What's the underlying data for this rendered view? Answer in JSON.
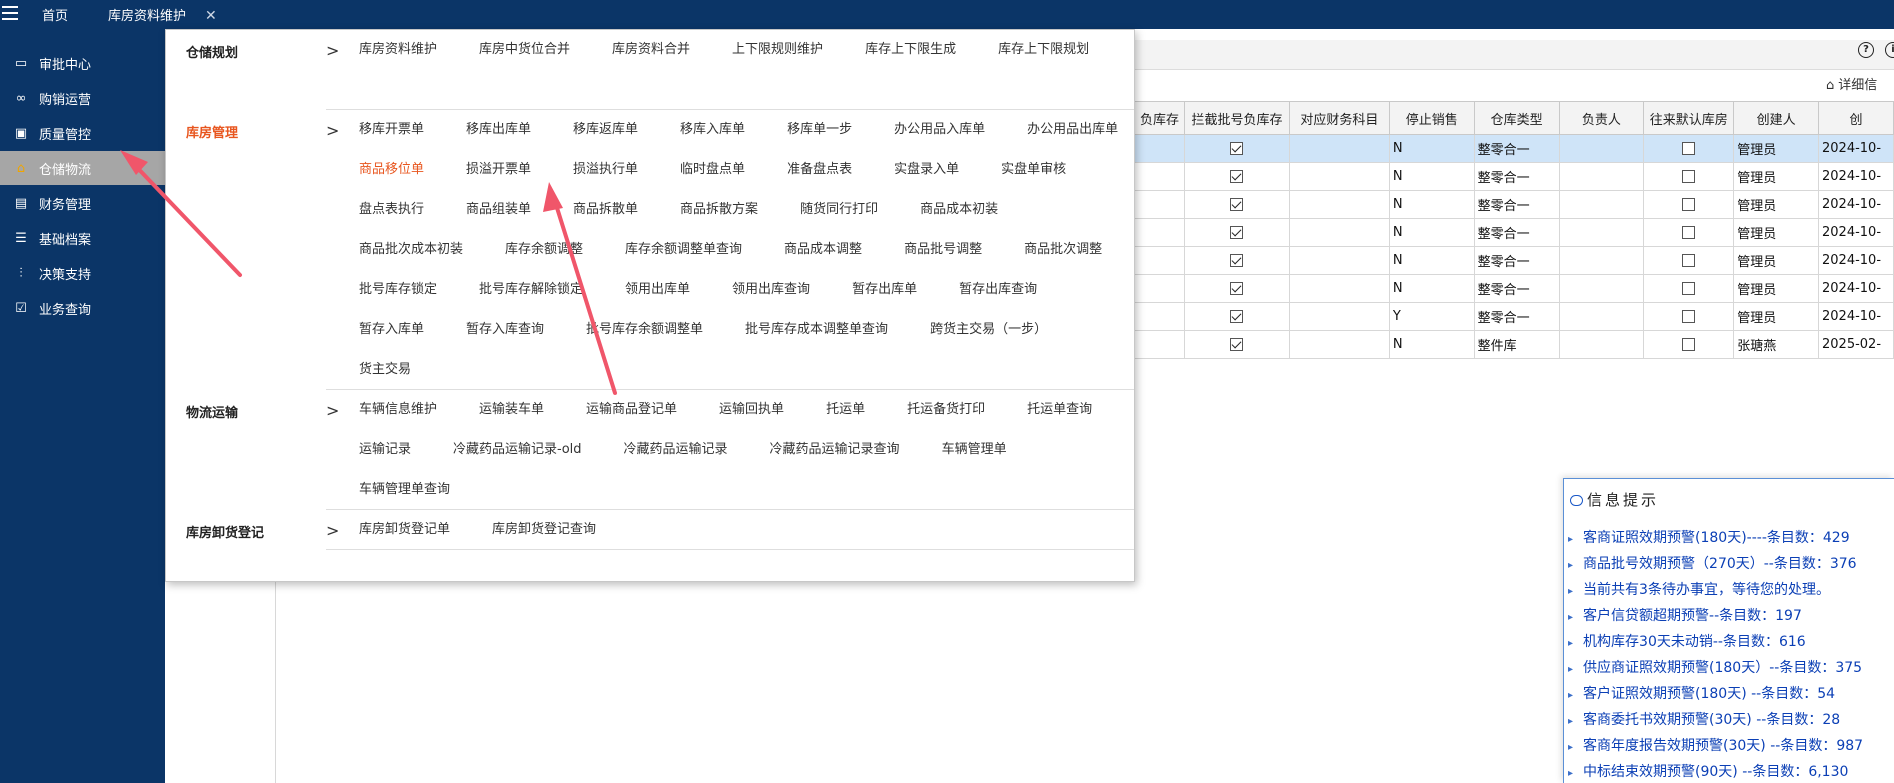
{
  "topbar": {
    "tabs": [
      {
        "label": "首页"
      },
      {
        "label": "库房资料维护"
      }
    ],
    "close_glyph": "✕"
  },
  "sidebar": {
    "items": [
      {
        "label": "审批中心",
        "icon": "monitor-icon"
      },
      {
        "label": "购销运营",
        "icon": "nodes-icon"
      },
      {
        "label": "质量管控",
        "icon": "display-icon"
      },
      {
        "label": "仓储物流",
        "icon": "home-icon",
        "active": true
      },
      {
        "label": "财务管理",
        "icon": "card-icon"
      },
      {
        "label": "基础档案",
        "icon": "sliders-icon"
      },
      {
        "label": "决策支持",
        "icon": "chart-icon"
      },
      {
        "label": "业务查询",
        "icon": "check-screen-icon"
      }
    ]
  },
  "header_icons": {
    "help": "?",
    "info": "i"
  },
  "detail_link": "详细信",
  "grid": {
    "columns": [
      "负库存",
      "拦截批号负库存",
      "对应财务科目",
      "停止销售",
      "仓库类型",
      "负责人",
      "往来默认库房",
      "创建人",
      "创"
    ],
    "rows": [
      {
        "stop_sale": "N",
        "type": "整零合一",
        "creator": "管理员",
        "created": "2024-10-",
        "intercept": true,
        "default_wh": false
      },
      {
        "stop_sale": "N",
        "type": "整零合一",
        "creator": "管理员",
        "created": "2024-10-",
        "intercept": true,
        "default_wh": false
      },
      {
        "stop_sale": "N",
        "type": "整零合一",
        "creator": "管理员",
        "created": "2024-10-",
        "intercept": true,
        "default_wh": false
      },
      {
        "stop_sale": "N",
        "type": "整零合一",
        "creator": "管理员",
        "created": "2024-10-",
        "intercept": true,
        "default_wh": false
      },
      {
        "stop_sale": "N",
        "type": "整零合一",
        "creator": "管理员",
        "created": "2024-10-",
        "intercept": true,
        "default_wh": false
      },
      {
        "stop_sale": "N",
        "type": "整零合一",
        "creator": "管理员",
        "created": "2024-10-",
        "intercept": true,
        "default_wh": false
      },
      {
        "stop_sale": "Y",
        "type": "整零合一",
        "creator": "管理员",
        "created": "2024-10-",
        "intercept": true,
        "default_wh": false
      },
      {
        "stop_sale": "N",
        "type": "整件库",
        "creator": "张瑭燕",
        "created": "2025-02-",
        "intercept": true,
        "default_wh": false
      }
    ],
    "selected_row": 0
  },
  "mega_menu": {
    "chevron": ">",
    "sections": [
      {
        "title": "仓储规划",
        "highlight": false,
        "items": [
          "库房资料维护",
          "库房中货位合并",
          "库房资料合并",
          "上下限规则维护",
          "库存上下限生成",
          "库存上下限规划"
        ]
      },
      {
        "title": "库房管理",
        "highlight": true,
        "highlight_item": "商品移位单",
        "items": [
          "移库开票单",
          "移库出库单",
          "移库返库单",
          "移库入库单",
          "移库单一步",
          "办公用品入库单",
          "办公用品出库单",
          "商品移位单",
          "损溢开票单",
          "损溢执行单",
          "临时盘点单",
          "准备盘点表",
          "实盘录入单",
          "实盘单审核",
          "盘点表执行",
          "商品组装单",
          "商品拆散单",
          "商品拆散方案",
          "随货同行打印",
          "商品成本初装",
          "商品批次成本初装",
          "库存余额调整",
          "库存余额调整单查询",
          "商品成本调整",
          "商品批号调整",
          "商品批次调整",
          "批号库存锁定",
          "批号库存解除锁定",
          "领用出库单",
          "领用出库查询",
          "暂存出库单",
          "暂存出库查询",
          "暂存入库单",
          "暂存入库查询",
          "批号库存余额调整单",
          "批号库存成本调整单查询",
          "跨货主交易（一步）",
          "货主交易"
        ]
      },
      {
        "title": "物流运输",
        "highlight": false,
        "items": [
          "车辆信息维护",
          "运输装车单",
          "运输商品登记单",
          "运输回执单",
          "托运单",
          "托运备货打印",
          "托运单查询",
          "运输记录",
          "冷藏药品运输记录-old",
          "冷藏药品运输记录",
          "冷藏药品运输记录查询",
          "车辆管理单",
          "车辆管理单查询"
        ]
      },
      {
        "title": "库房卸货登记",
        "highlight": false,
        "items": [
          "库房卸货登记单",
          "库房卸货登记查询"
        ]
      }
    ]
  },
  "info_panel": {
    "title": "信息提示",
    "items": [
      "客商证照效期预警(180天)----条目数：429",
      "商品批号效期预警（270天）--条目数：376",
      "当前共有3条待办事宜，等待您的处理。",
      "客户信贷额超期预警--条目数：197",
      "机构库存30天未动销--条目数：616",
      "供应商证照效期预警(180天）--条目数：375",
      "客户证照效期预警(180天) --条目数：54",
      "客商委托书效期预警(30天) --条目数：28",
      "客商年度报告效期预警(30天) --条目数：987",
      "中标结束效期预警(90天) --条目数：6,130"
    ]
  },
  "colors": {
    "nav_bg": "#0b3567",
    "active_bg": "#a6a6a6",
    "highlight": "#e8561f",
    "link_blue": "#0b3fb5",
    "arrow_red": "#f0566a"
  }
}
